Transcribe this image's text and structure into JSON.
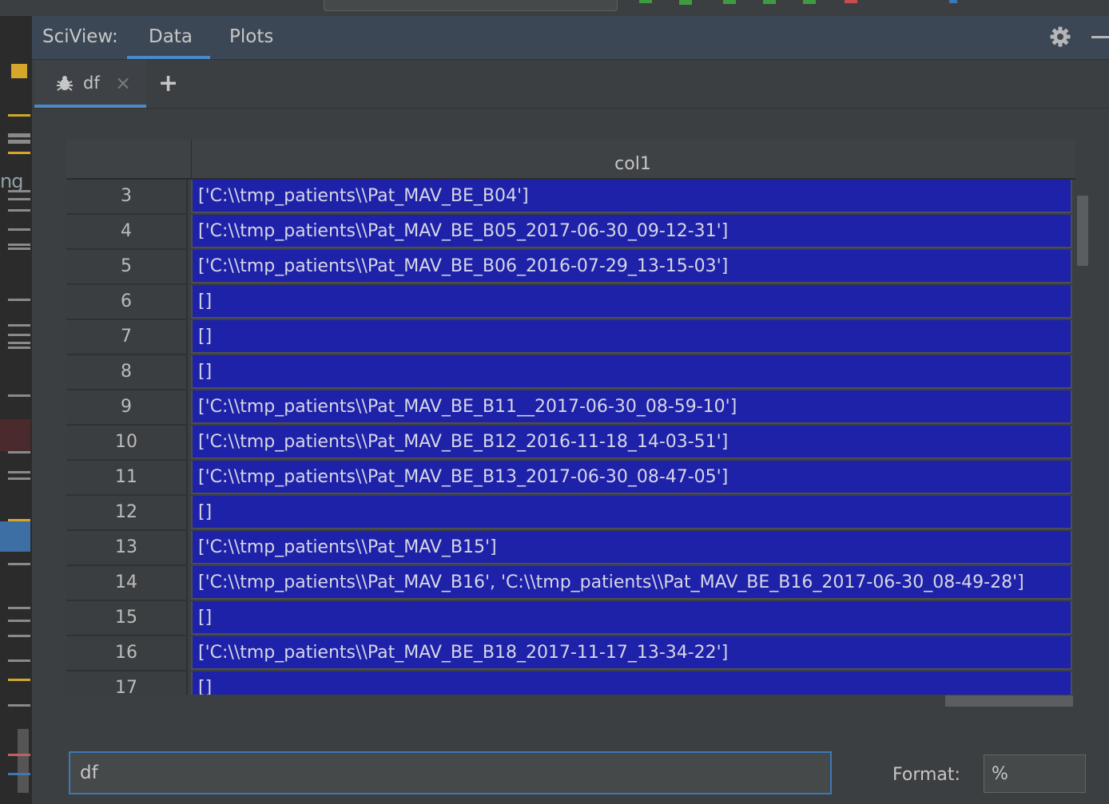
{
  "window": {
    "panel_title": "SciView:",
    "tabs": [
      {
        "label": "Data",
        "active": true
      },
      {
        "label": "Plots",
        "active": false
      }
    ]
  },
  "df_tabs": [
    {
      "label": "df",
      "icon": "bug-icon"
    }
  ],
  "table": {
    "column_header": "col1",
    "rows": [
      {
        "index": "3",
        "value": "['C:\\\\tmp_patients\\\\Pat_MAV_BE_B04']"
      },
      {
        "index": "4",
        "value": "['C:\\\\tmp_patients\\\\Pat_MAV_BE_B05_2017-06-30_09-12-31']"
      },
      {
        "index": "5",
        "value": "['C:\\\\tmp_patients\\\\Pat_MAV_BE_B06_2016-07-29_13-15-03']"
      },
      {
        "index": "6",
        "value": "[]"
      },
      {
        "index": "7",
        "value": "[]"
      },
      {
        "index": "8",
        "value": "[]"
      },
      {
        "index": "9",
        "value": "['C:\\\\tmp_patients\\\\Pat_MAV_BE_B11__2017-06-30_08-59-10']"
      },
      {
        "index": "10",
        "value": "['C:\\\\tmp_patients\\\\Pat_MAV_BE_B12_2016-11-18_14-03-51']"
      },
      {
        "index": "11",
        "value": "['C:\\\\tmp_patients\\\\Pat_MAV_BE_B13_2017-06-30_08-47-05']"
      },
      {
        "index": "12",
        "value": "[]"
      },
      {
        "index": "13",
        "value": "['C:\\\\tmp_patients\\\\Pat_MAV_B15']"
      },
      {
        "index": "14",
        "value": "['C:\\\\tmp_patients\\\\Pat_MAV_B16', 'C:\\\\tmp_patients\\\\Pat_MAV_BE_B16_2017-06-30_08-49-28']"
      },
      {
        "index": "15",
        "value": "[]"
      },
      {
        "index": "16",
        "value": "['C:\\\\tmp_patients\\\\Pat_MAV_BE_B18_2017-11-17_13-34-22']"
      },
      {
        "index": "17",
        "value": "[]"
      }
    ]
  },
  "bottom": {
    "expression_value": "df",
    "format_label": "Format:",
    "format_value": "%"
  },
  "gutter_text": "ng",
  "colors": {
    "selection": "#1e22a8",
    "accent": "#4a88c7",
    "header_bg": "#3c4756"
  }
}
